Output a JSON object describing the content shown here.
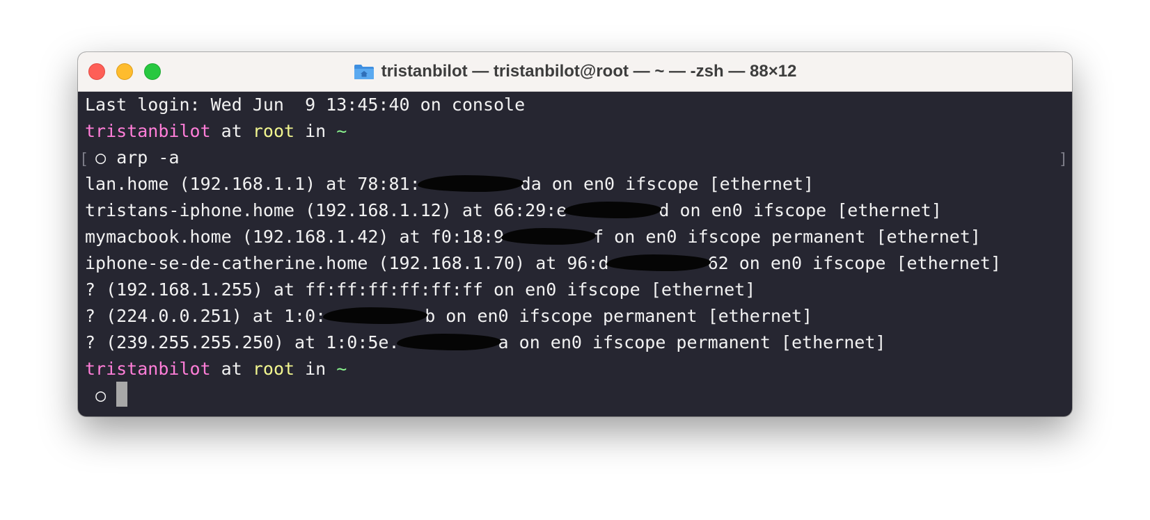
{
  "window": {
    "title": "tristanbilot — tristanbilot@root — ~ — -zsh — 88×12",
    "folder_icon": "folder-home-icon",
    "controls": [
      "close",
      "minimize",
      "maximize"
    ],
    "colors": {
      "background": "#262631",
      "text": "#f2f2f2",
      "user": "#ff7ed8",
      "host": "#f1f58f",
      "path": "#8bf58f"
    }
  },
  "terminal": {
    "last_login": "Last login: Wed Jun  9 13:45:40 on console",
    "prompt1": {
      "user": "tristanbilot",
      "at": " at ",
      "host": "root",
      "in": " in ",
      "path": "~"
    },
    "command_line": {
      "symbol": "○",
      "command": "arp -a"
    },
    "arp_lines": [
      {
        "pre": "lan.home (192.168.1.1) at 78:81:",
        "redacted": true,
        "post": "da on en0 ifscope [ethernet]"
      },
      {
        "pre": "tristans-iphone.home (192.168.1.12) at 66:29:e",
        "redacted": true,
        "post": "d on en0 ifscope [ethernet]"
      },
      {
        "pre": "mymacbook.home (192.168.1.42) at f0:18:9",
        "redacted": true,
        "post": "f on en0 ifscope permanent [ethernet]"
      },
      {
        "pre": "iphone-se-de-catherine.home (192.168.1.70) at 96:d",
        "redacted": true,
        "post": "62 on en0 ifscope [ethernet]"
      },
      {
        "pre": "? (192.168.1.255) at ff:ff:ff:ff:ff:ff on en0 ifscope [ethernet]",
        "redacted": false,
        "post": ""
      },
      {
        "pre": "? (224.0.0.251) at 1:0:",
        "redacted": true,
        "post": "b on en0 ifscope permanent [ethernet]"
      },
      {
        "pre": "? (239.255.255.250) at 1:0:5e.",
        "redacted": true,
        "post": "a on en0 ifscope permanent [ethernet]"
      }
    ],
    "prompt2": {
      "user": "tristanbilot",
      "at": " at ",
      "host": "root",
      "in": " in ",
      "path": "~"
    },
    "input_line": {
      "symbol": "○",
      "value": ""
    }
  }
}
